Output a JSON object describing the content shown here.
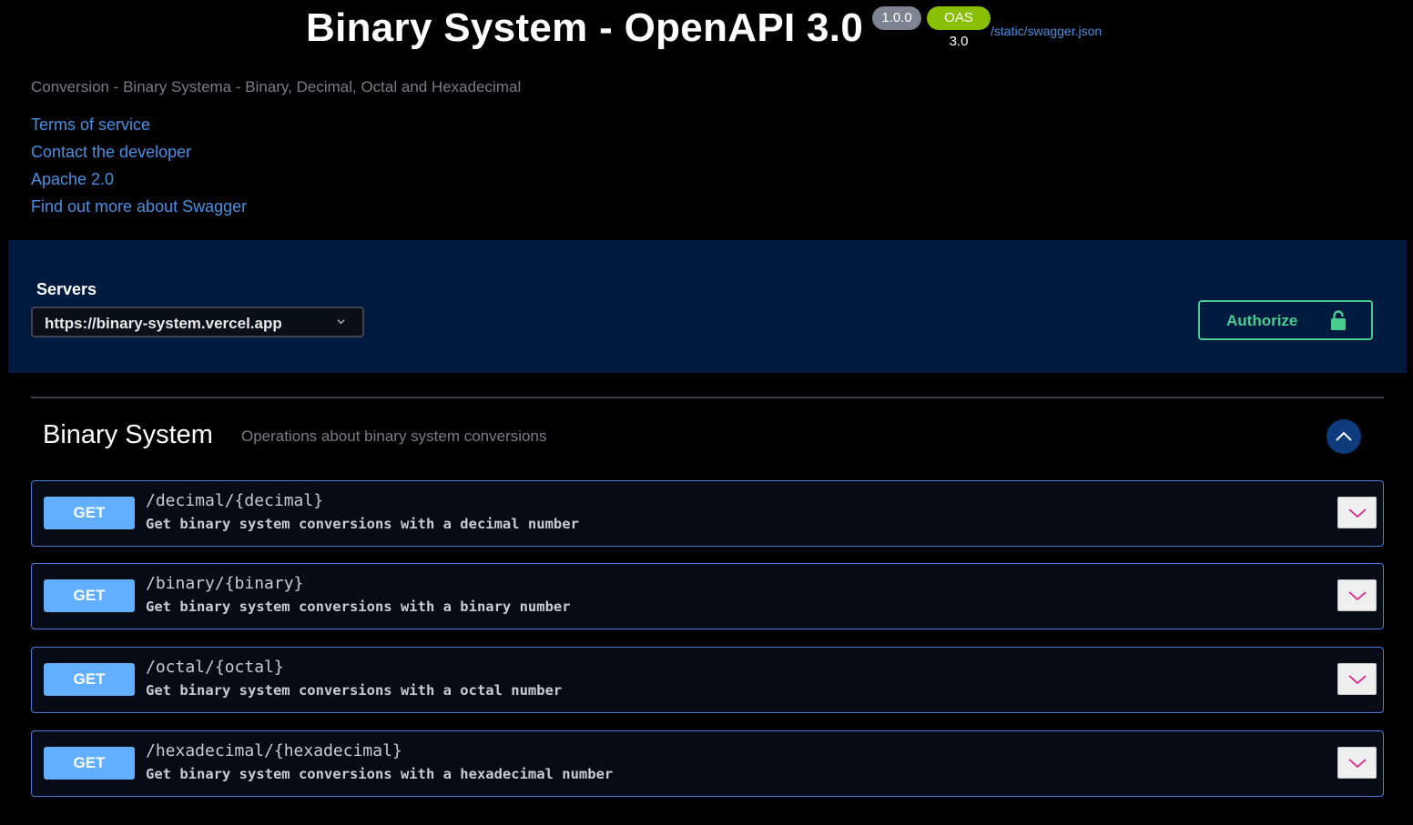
{
  "info": {
    "title": "Binary System - OpenAPI 3.0",
    "version": "1.0.0",
    "oas": "OAS 3.0",
    "spec_url": "/static/swagger.json",
    "description": "Conversion - Binary Systema - Binary, Decimal, Octal and Hexadecimal",
    "links": [
      "Terms of service",
      "Contact the developer",
      "Apache 2.0",
      "Find out more about Swagger"
    ]
  },
  "servers": {
    "label": "Servers",
    "selected": "https://binary-system.vercel.app"
  },
  "authorize": {
    "label": "Authorize"
  },
  "tag": {
    "name": "Binary System",
    "description": "Operations about binary system conversions"
  },
  "operations": [
    {
      "method": "GET",
      "path": "/decimal/{decimal}",
      "summary": "Get binary system conversions with a decimal number"
    },
    {
      "method": "GET",
      "path": "/binary/{binary}",
      "summary": "Get binary system conversions with a binary number"
    },
    {
      "method": "GET",
      "path": "/octal/{octal}",
      "summary": "Get binary system conversions with a octal number"
    },
    {
      "method": "GET",
      "path": "/hexadecimal/{hexadecimal}",
      "summary": "Get binary system conversions with a hexadecimal number"
    }
  ],
  "colors": {
    "background": "#000000",
    "scheme_background": "#001a40",
    "get_method": "#61affe",
    "authorize": "#49cc90",
    "link": "#4990e2",
    "oas_badge": "#89bf04",
    "version_badge": "#7d8492",
    "expand_chevron": "#e6198a"
  },
  "icons": {
    "lock": "lock-icon",
    "select_chevron": "chevron-down-icon",
    "tag_toggle": "chevron-up-icon",
    "op_expand": "chevron-down-icon"
  }
}
